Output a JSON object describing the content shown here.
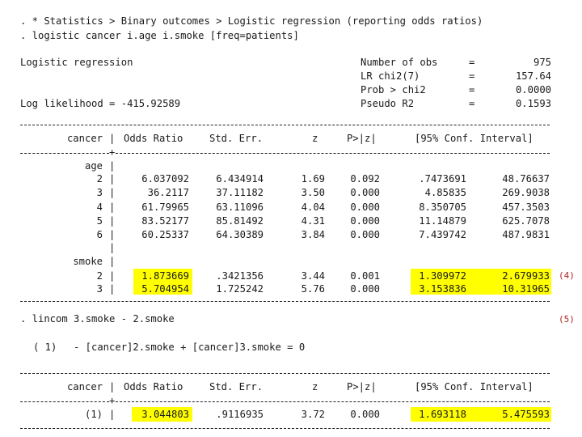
{
  "cmd1": ". * Statistics > Binary outcomes > Logistic regression (reporting odds ratios)",
  "cmd2": ". logistic cancer i.age i.smoke [freq=patients]",
  "title": "Logistic regression",
  "ll": "Log likelihood = -415.92589",
  "stats": [
    {
      "label": "Number of obs",
      "eq": "=",
      "value": "975"
    },
    {
      "label": "LR chi2(7)",
      "eq": "=",
      "value": "157.64"
    },
    {
      "label": "Prob > chi2",
      "eq": "=",
      "value": "0.0000"
    },
    {
      "label": "Pseudo R2",
      "eq": "=",
      "value": "0.1593"
    }
  ],
  "table1": {
    "depvar": "cancer",
    "headers": {
      "or": "Odds Ratio",
      "se": "Std. Err.",
      "z": "z",
      "p": "P>|z|",
      "ci": "[95% Conf. Interval]"
    },
    "age_label": "age",
    "age_rows": [
      {
        "lvl": "2",
        "or": "6.037092",
        "se": "6.434914",
        "z": "1.69",
        "p": "0.092",
        "lo": ".7473691",
        "hi": "48.76637"
      },
      {
        "lvl": "3",
        "or": "36.2117",
        "se": "37.11182",
        "z": "3.50",
        "p": "0.000",
        "lo": "4.85835",
        "hi": "269.9038"
      },
      {
        "lvl": "4",
        "or": "61.79965",
        "se": "63.11096",
        "z": "4.04",
        "p": "0.000",
        "lo": "8.350705",
        "hi": "457.3503"
      },
      {
        "lvl": "5",
        "or": "83.52177",
        "se": "85.81492",
        "z": "4.31",
        "p": "0.000",
        "lo": "11.14879",
        "hi": "625.7078"
      },
      {
        "lvl": "6",
        "or": "60.25337",
        "se": "64.30389",
        "z": "3.84",
        "p": "0.000",
        "lo": "7.439742",
        "hi": "487.9831"
      }
    ],
    "smoke_label": "smoke",
    "smoke_rows": [
      {
        "lvl": "2",
        "or": "1.873669",
        "se": ".3421356",
        "z": "3.44",
        "p": "0.001",
        "lo": "1.309972",
        "hi": "2.679933"
      },
      {
        "lvl": "3",
        "or": "5.704954",
        "se": "1.725242",
        "z": "5.76",
        "p": "0.000",
        "lo": "3.153836",
        "hi": "10.31965"
      }
    ]
  },
  "note4": "(4)",
  "cmd3": ". lincom 3.smoke - 2.smoke",
  "note5": "(5)",
  "eqn_id": "( 1)",
  "eqn": "- [cancer]2.smoke + [cancer]3.smoke = 0",
  "table2": {
    "depvar": "cancer",
    "headers": {
      "or": "Odds Ratio",
      "se": "Std. Err.",
      "z": "z",
      "p": "P>|z|",
      "ci": "[95% Conf. Interval]"
    },
    "row": {
      "lvl": "(1)",
      "or": "3.044803",
      "se": ".9116935",
      "z": "3.72",
      "p": "0.000",
      "lo": "1.693118",
      "hi": "5.475593"
    }
  }
}
